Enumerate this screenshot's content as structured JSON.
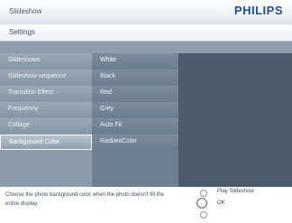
{
  "window": {
    "title": "Slideshow",
    "brand": "PHILIPS"
  },
  "breadcrumb": {
    "label": "Settings"
  },
  "menu": {
    "items": [
      {
        "label": "Slideshows"
      },
      {
        "label": "Slideshow sequence"
      },
      {
        "label": "Transition Effect"
      },
      {
        "label": "Frequency"
      },
      {
        "label": "Collage"
      },
      {
        "label": "Background Color",
        "selected": true
      }
    ]
  },
  "submenu": {
    "items": [
      {
        "label": "White"
      },
      {
        "label": "Black"
      },
      {
        "label": "Red"
      },
      {
        "label": "Grey"
      },
      {
        "label": "Auto Fit"
      },
      {
        "label": "RadiantColor"
      }
    ]
  },
  "footer": {
    "description": "Choose the photo background color when the photo doesn't fill the entire display.",
    "actions": [
      {
        "label": "Play Slideshow"
      },
      {
        "label": "OK"
      },
      {
        "label": ""
      }
    ]
  }
}
